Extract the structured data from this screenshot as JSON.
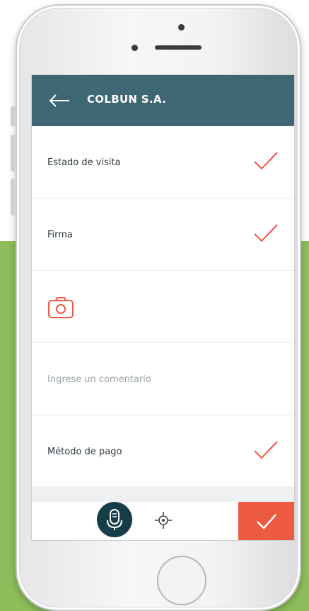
{
  "header": {
    "title": "COLBUN S.A.",
    "back_icon": "arrow-left-icon"
  },
  "rows": [
    {
      "label": "Estado de visita",
      "status": "checked"
    },
    {
      "label": "Firma",
      "status": "checked"
    },
    {
      "icon": "camera-icon"
    },
    {
      "placeholder": "Ingrese un comentario"
    },
    {
      "label": "Método de pago",
      "status": "checked"
    }
  ],
  "bottom_bar": {
    "mic_icon": "microphone-icon",
    "locate_icon": "crosshair-icon",
    "confirm_icon": "checkmark-icon"
  },
  "colors": {
    "header": "#3f6674",
    "accent": "#ec5a44",
    "mic_button": "#173d49",
    "background_green": "#8dbe5b"
  }
}
